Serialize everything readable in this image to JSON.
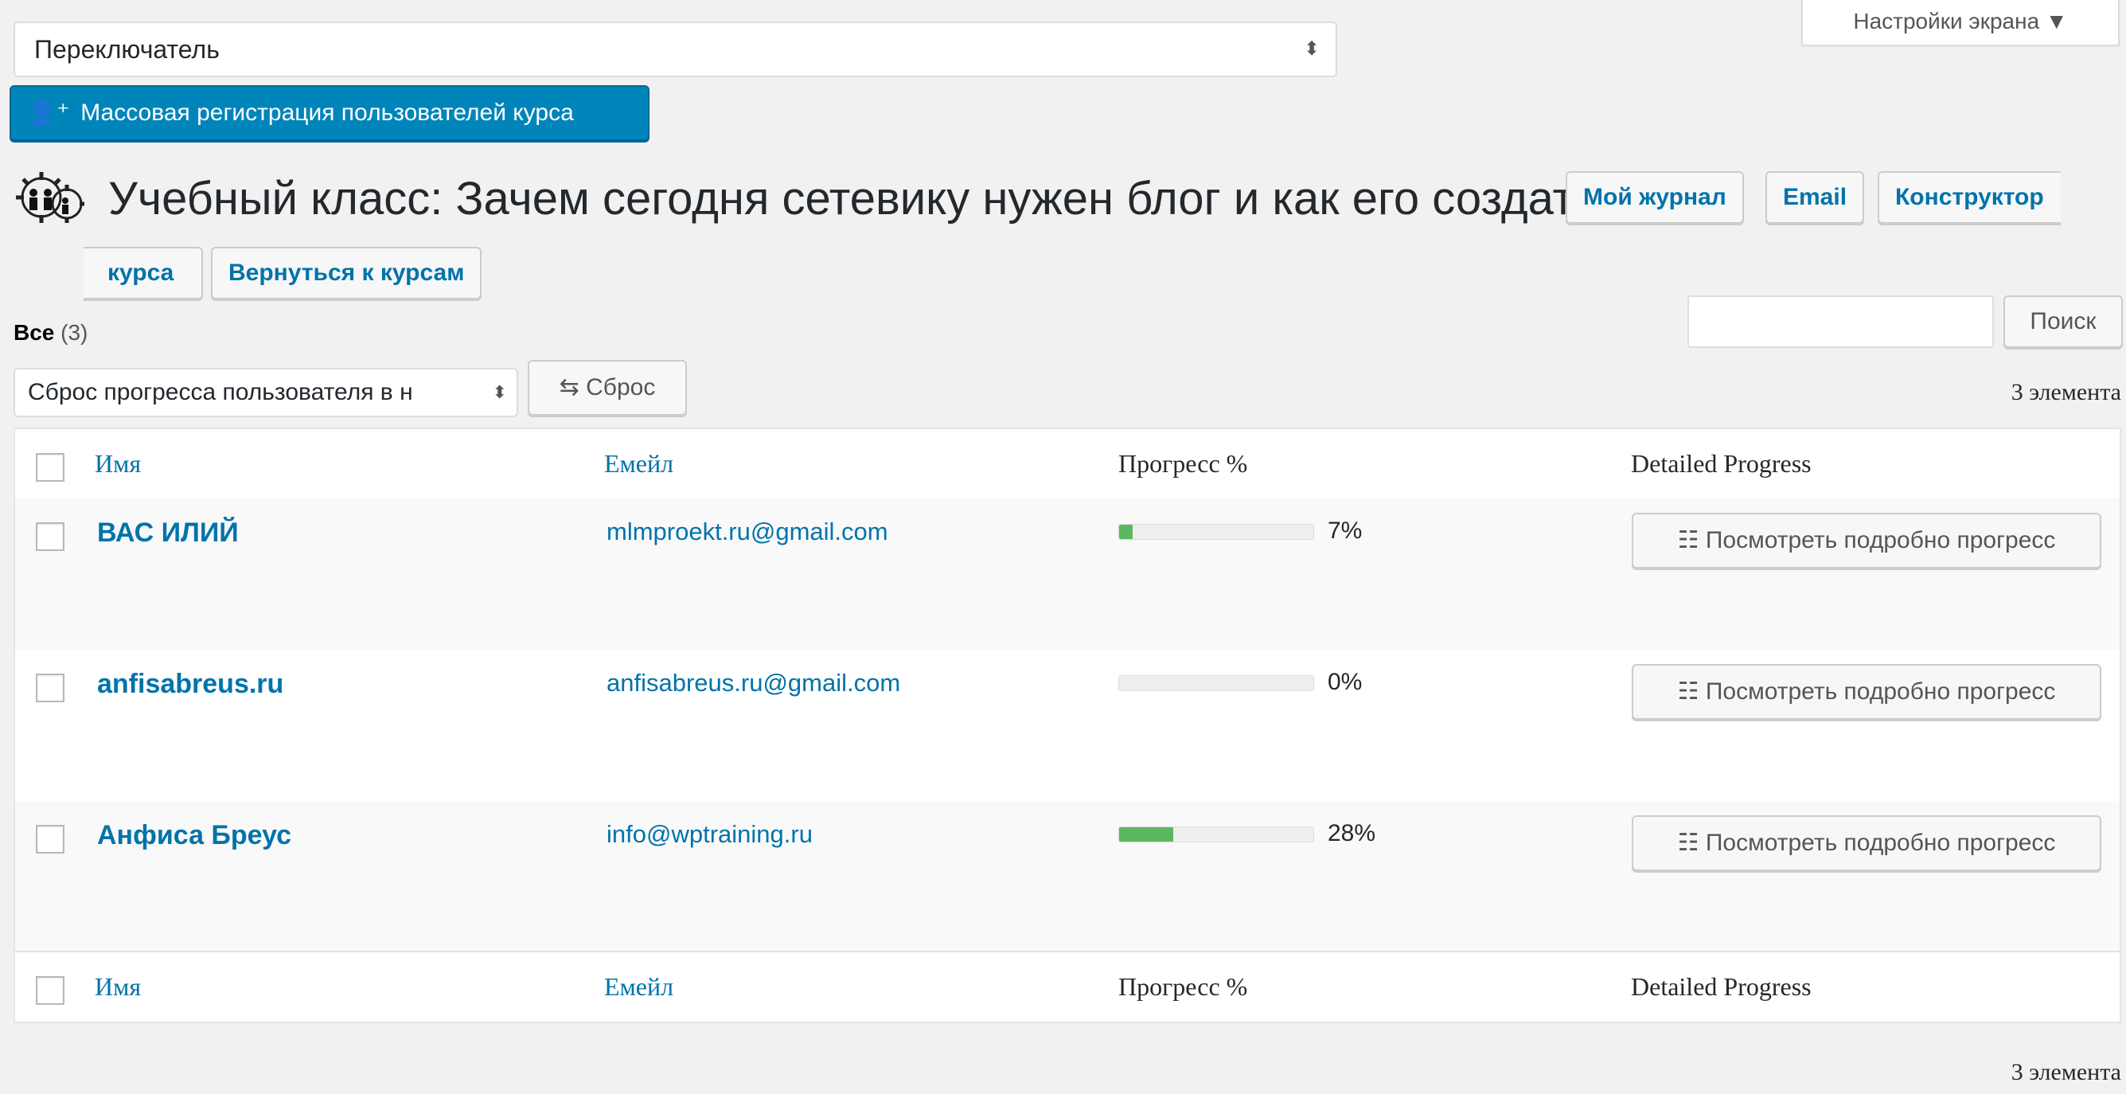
{
  "top": {
    "switcher_value": "Переключатель",
    "screen_options": "Настройки экрана ▼",
    "bulk_register_label": "Массовая регистрация пользователей курса"
  },
  "heading": {
    "title": "Учебный класс: Зачем сегодня сетевику нужен блог и как его создать!",
    "buttons": [
      "Мой журнал",
      "Email",
      "Конструктор",
      "курса",
      "Вернуться к курсам"
    ]
  },
  "filters": {
    "all_label": "Все",
    "all_count": "(3)",
    "search_button": "Поиск",
    "bulk_action_value": "Сброс прогресса пользователя в н",
    "reset_button": "Сброс",
    "items_count": "3 элемента"
  },
  "table": {
    "columns": [
      "Имя",
      "Емейл",
      "Прогресс %",
      "Detailed Progress"
    ],
    "rows": [
      {
        "name": "ВАС ИЛИЙ",
        "email": "mlmproekt.ru@gmail.com",
        "progress": 7,
        "progress_label": "7%",
        "detail_button": "Посмотреть подробно прогресс"
      },
      {
        "name": "anfisabreus.ru",
        "email": "anfisabreus.ru@gmail.com",
        "progress": 0,
        "progress_label": "0%",
        "detail_button": "Посмотреть подробно прогресс"
      },
      {
        "name": "Анфиса Бреус",
        "email": "info@wptraining.ru",
        "progress": 28,
        "progress_label": "28%",
        "detail_button": "Посмотреть подробно прогресс"
      }
    ]
  },
  "colors": {
    "primary": "#0085ba",
    "link": "#0073aa",
    "progress_fill": "#5cb85c"
  },
  "icons": {
    "bulk_register": "add-user-icon",
    "reset": "repeat-icon",
    "detail": "checklist-icon",
    "logo": "gear-people-logo-icon"
  }
}
